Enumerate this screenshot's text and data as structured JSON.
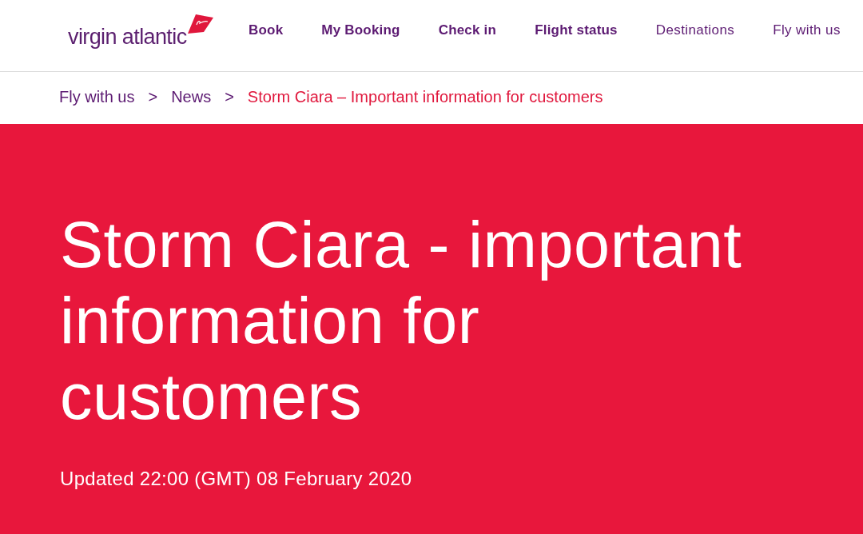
{
  "header": {
    "logo": {
      "wordmark": "virgin atlantic"
    },
    "nav": [
      {
        "label": "Book",
        "kind": "primary"
      },
      {
        "label": "My Booking",
        "kind": "primary"
      },
      {
        "label": "Check in",
        "kind": "primary"
      },
      {
        "label": "Flight status",
        "kind": "primary"
      },
      {
        "label": "Destinations",
        "kind": "secondary"
      },
      {
        "label": "Fly with us",
        "kind": "secondary"
      }
    ]
  },
  "breadcrumb": [
    {
      "label": "Fly with us",
      "kind": "link"
    },
    {
      "label": ">",
      "kind": "separator"
    },
    {
      "label": "News",
      "kind": "link"
    },
    {
      "label": ">",
      "kind": "separator"
    },
    {
      "label": "Storm Ciara – Important information for customers",
      "kind": "current"
    }
  ],
  "hero": {
    "title": "Storm Ciara - important information for customers",
    "updated": "Updated 22:00 (GMT) 08 February 2020"
  }
}
